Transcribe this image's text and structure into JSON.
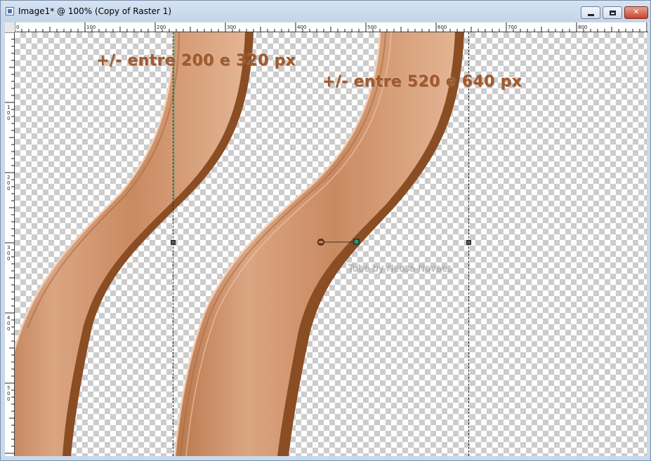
{
  "window": {
    "title": "Image1* @ 100% (Copy of Raster 1)",
    "buttons": {
      "minimize": "minimize",
      "maximize": "maximize",
      "close": "✕"
    }
  },
  "rulers": {
    "top_labels": [
      "0",
      "100",
      "200",
      "300",
      "400",
      "500",
      "600",
      "700",
      "800"
    ],
    "left_labels": [
      "1\n0\n0",
      "2\n0\n0",
      "3\n0\n0",
      "4\n0\n0",
      "5\n0\n0"
    ]
  },
  "canvas": {
    "annotations": [
      "+/- entre 200 e 320 px",
      "+/- entre 520 e 640 px"
    ],
    "watermark": "Tube by Neusa Novaes",
    "colors": {
      "tube_light": "#e2b08f",
      "tube_mid": "#c8895f",
      "tube_dark": "#8a4d24",
      "text": "#a25a2c",
      "checker": "#cccccc"
    }
  },
  "icons": [
    "app-icon",
    "minimize-icon",
    "maximize-icon",
    "close-icon",
    "pick-handle-icon"
  ]
}
